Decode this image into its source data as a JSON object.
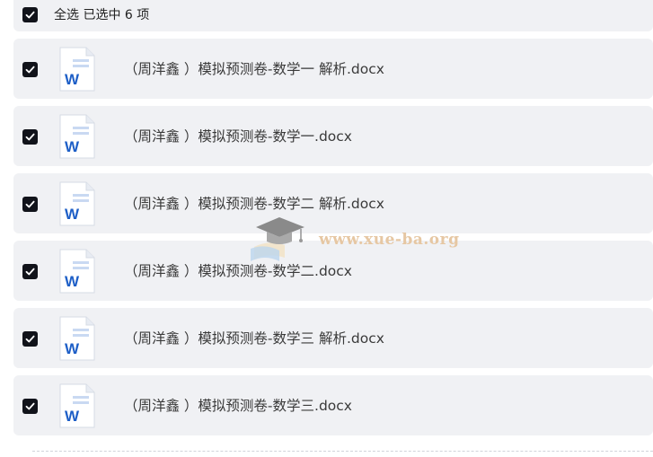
{
  "header": {
    "select_all_label": "全选 已选中 6 项",
    "checked": true
  },
  "files": [
    {
      "name": "（周洋鑫 ）模拟预测卷-数学一 解析.docx",
      "checked": true,
      "icon": "word-doc-icon"
    },
    {
      "name": "（周洋鑫 ）模拟预测卷-数学一.docx",
      "checked": true,
      "icon": "word-doc-icon"
    },
    {
      "name": "（周洋鑫 ）模拟预测卷-数学二 解析.docx",
      "checked": true,
      "icon": "word-doc-icon"
    },
    {
      "name": "（周洋鑫 ）模拟预测卷-数学二.docx",
      "checked": true,
      "icon": "word-doc-icon"
    },
    {
      "name": "（周洋鑫 ）模拟预测卷-数学三 解析.docx",
      "checked": true,
      "icon": "word-doc-icon"
    },
    {
      "name": "（周洋鑫 ）模拟预测卷-数学三.docx",
      "checked": true,
      "icon": "word-doc-icon"
    }
  ],
  "watermark": {
    "text": "www.xue-ba.org"
  },
  "colors": {
    "row_bg": "#f0f1f4",
    "checkbox": "#11131a",
    "word_blue": "#1e5fc7"
  }
}
